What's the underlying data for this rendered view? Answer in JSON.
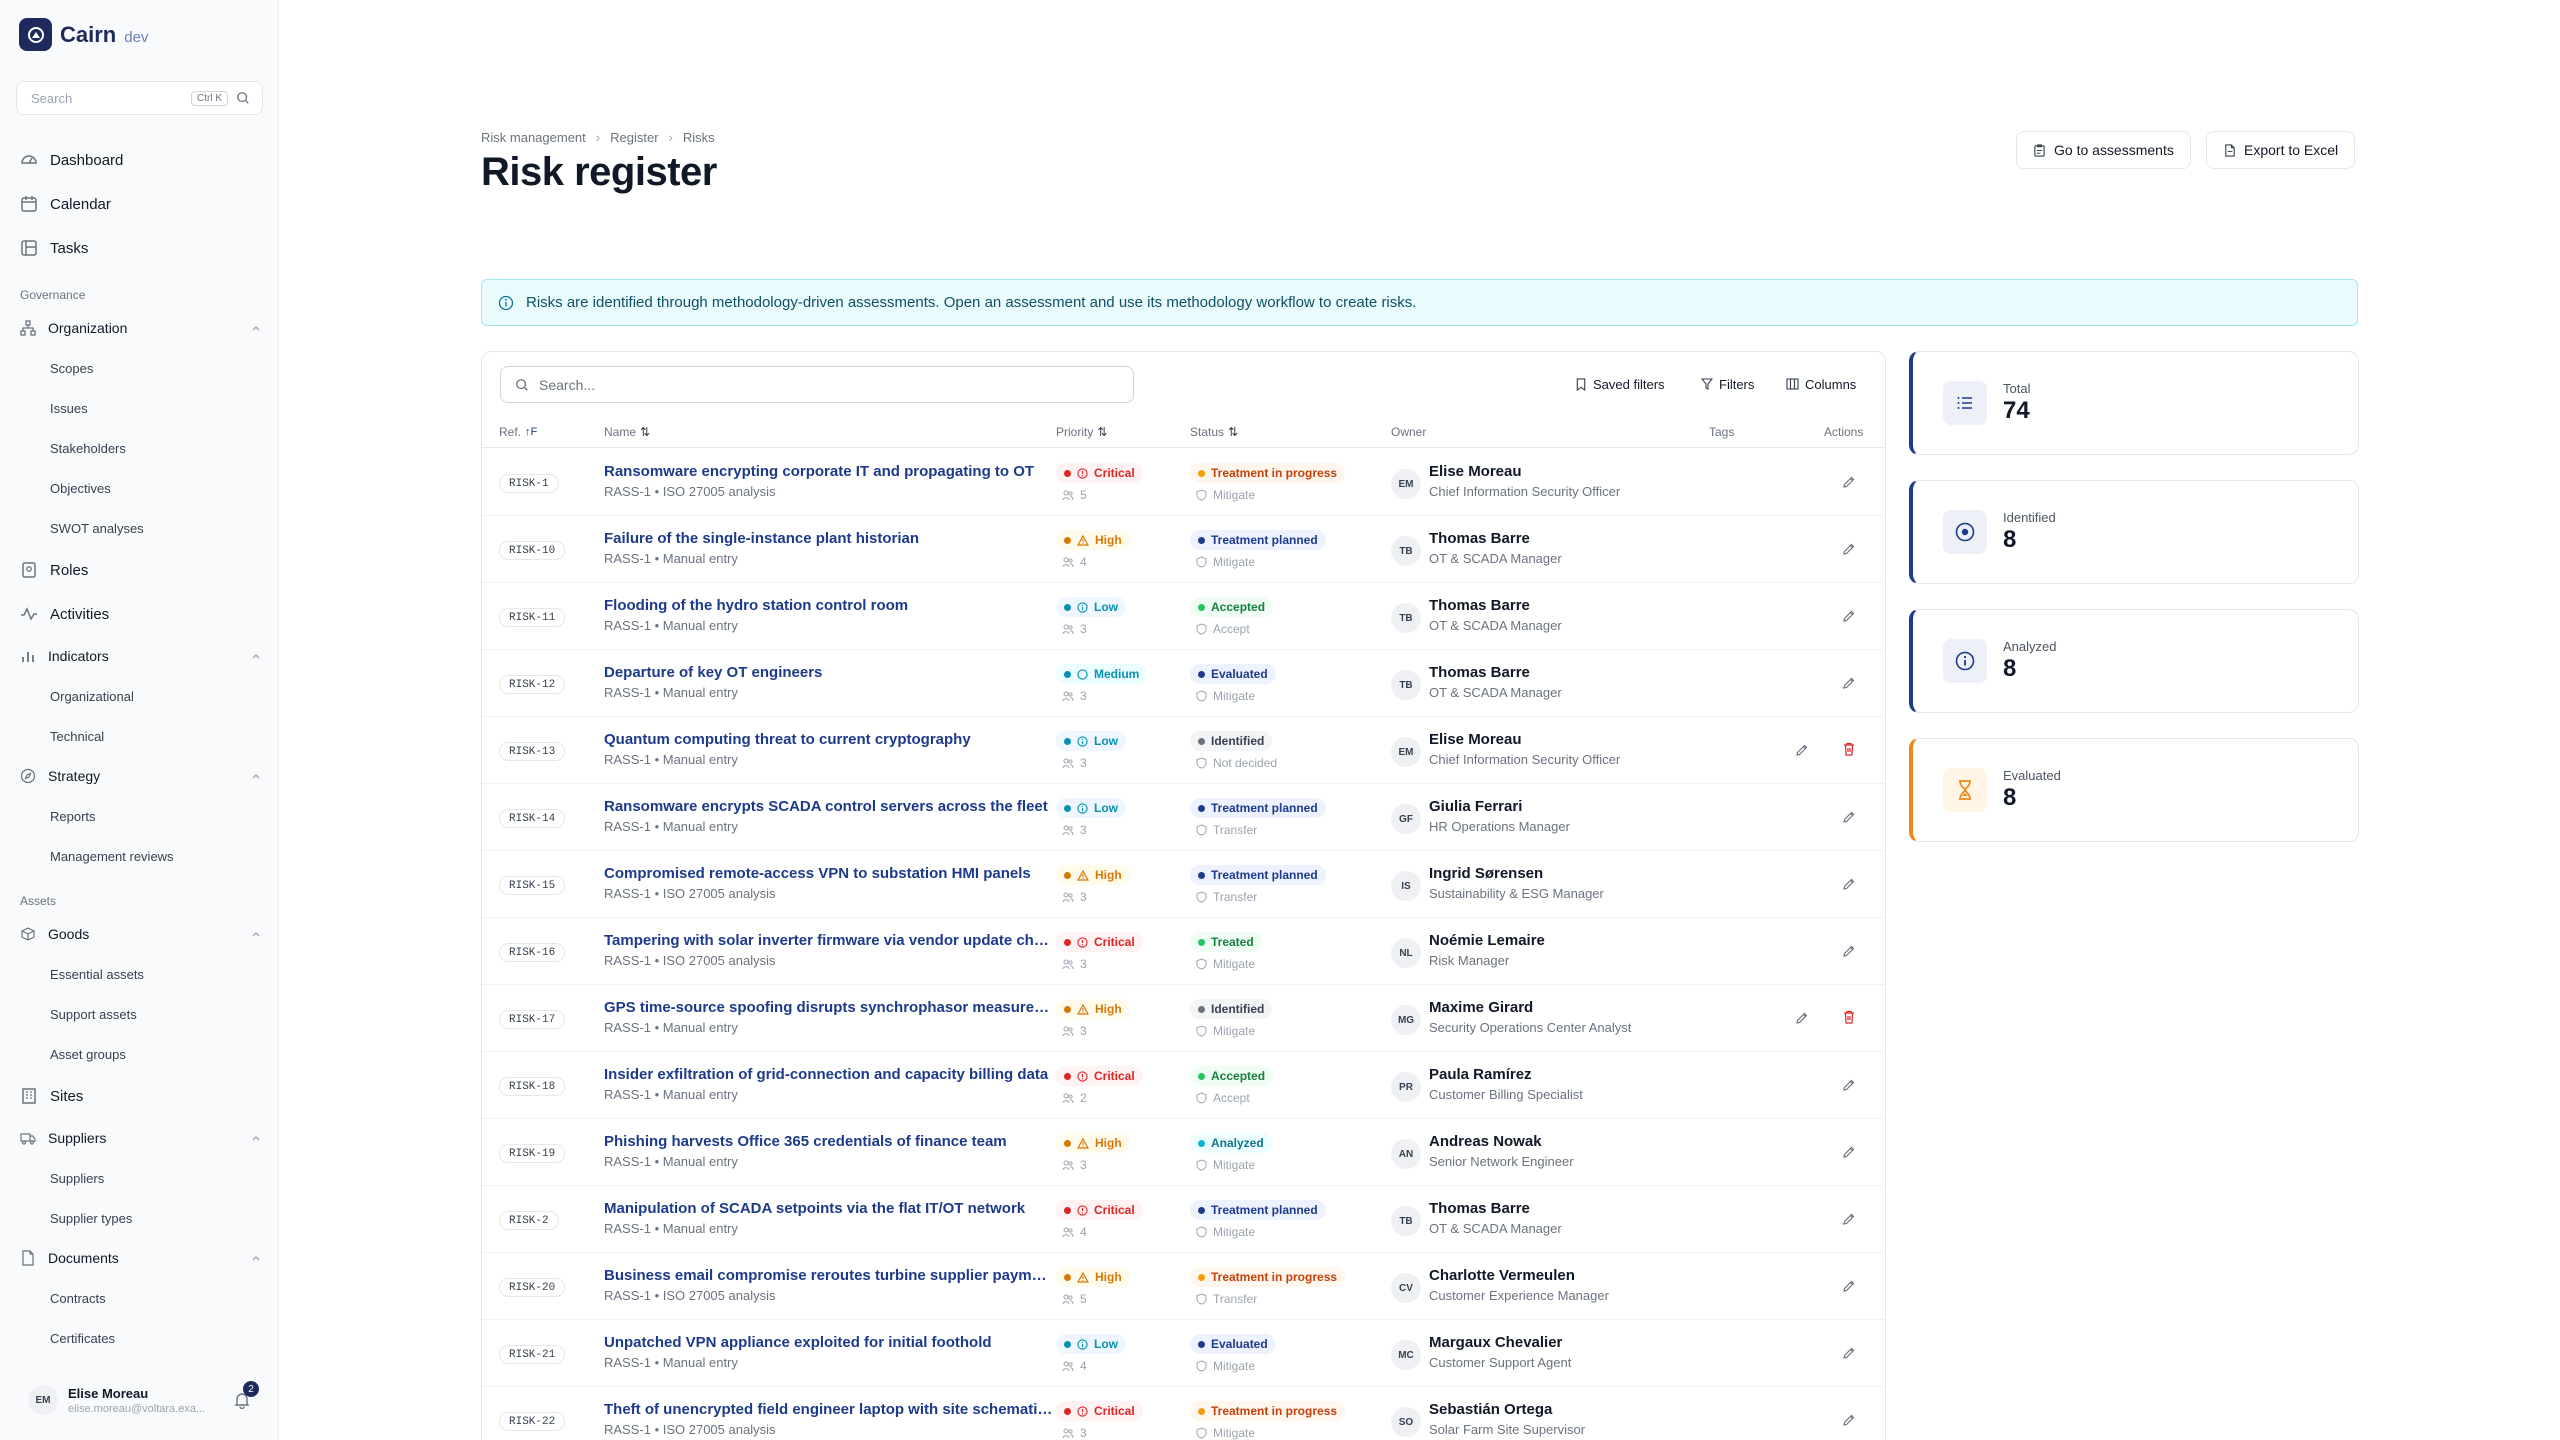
{
  "app": {
    "name": "Cairn",
    "env": "dev"
  },
  "sidebar": {
    "search_placeholder": "Search",
    "search_kbd": "Ctrl K",
    "top_items": [
      {
        "label": "Dashboard",
        "icon": "dashboard-icon"
      },
      {
        "label": "Calendar",
        "icon": "calendar-icon"
      },
      {
        "label": "Tasks",
        "icon": "tasks-icon"
      }
    ],
    "sections": {
      "governance": "Governance",
      "assets": "Assets"
    },
    "organization": {
      "label": "Organization",
      "subs": [
        "Scopes",
        "Issues",
        "Stakeholders",
        "Objectives",
        "SWOT analyses"
      ]
    },
    "roles": "Roles",
    "activities": "Activities",
    "indicators": {
      "label": "Indicators",
      "subs": [
        "Organizational",
        "Technical"
      ]
    },
    "strategy": {
      "label": "Strategy",
      "subs": [
        "Reports",
        "Management reviews"
      ]
    },
    "goods": {
      "label": "Goods",
      "subs": [
        "Essential assets",
        "Support assets",
        "Asset groups"
      ]
    },
    "sites": "Sites",
    "suppliers": {
      "label": "Suppliers",
      "subs": [
        "Suppliers",
        "Supplier types"
      ]
    },
    "documents": {
      "label": "Documents",
      "subs": [
        "Contracts",
        "Certificates"
      ]
    },
    "user": {
      "initials": "EM",
      "name": "Elise Moreau",
      "email": "elise.moreau@voltara.exa...",
      "notifications": "2"
    }
  },
  "header": {
    "breadcrumb": [
      "Risk management",
      "Register",
      "Risks"
    ],
    "title": "Risk register",
    "go_to_assessments": "Go to assessments",
    "export": "Export to Excel"
  },
  "banner": "Risks are identified through methodology-driven assessments. Open an assessment and use its methodology workflow to create risks.",
  "table": {
    "search_placeholder": "Search...",
    "saved_filters": "Saved filters",
    "filters": "Filters",
    "columns": "Columns",
    "headers": {
      "ref": "Ref.",
      "name": "Name",
      "priority": "Priority",
      "status": "Status",
      "owner": "Owner",
      "tags": "Tags",
      "actions": "Actions"
    },
    "rows": [
      {
        "ref": "RISK-1",
        "name": "Ransomware encrypting corporate IT and propagating to OT",
        "source": "RASS-1 • ISO 27005 analysis",
        "priority": "Critical",
        "count": "5",
        "status": "Treatment in progress",
        "treatment": "Mitigate",
        "initials": "EM",
        "owner": "Elise Moreau",
        "role": "Chief Information Security Officer",
        "delete": false
      },
      {
        "ref": "RISK-10",
        "name": "Failure of the single-instance plant historian",
        "source": "RASS-1 • Manual entry",
        "priority": "High",
        "count": "4",
        "status": "Treatment planned",
        "treatment": "Mitigate",
        "initials": "TB",
        "owner": "Thomas Barre",
        "role": "OT & SCADA Manager",
        "delete": false
      },
      {
        "ref": "RISK-11",
        "name": "Flooding of the hydro station control room",
        "source": "RASS-1 • Manual entry",
        "priority": "Low",
        "count": "3",
        "status": "Accepted",
        "treatment": "Accept",
        "initials": "TB",
        "owner": "Thomas Barre",
        "role": "OT & SCADA Manager",
        "delete": false
      },
      {
        "ref": "RISK-12",
        "name": "Departure of key OT engineers",
        "source": "RASS-1 • Manual entry",
        "priority": "Medium",
        "count": "3",
        "status": "Evaluated",
        "treatment": "Mitigate",
        "initials": "TB",
        "owner": "Thomas Barre",
        "role": "OT & SCADA Manager",
        "delete": false
      },
      {
        "ref": "RISK-13",
        "name": "Quantum computing threat to current cryptography",
        "source": "RASS-1 • Manual entry",
        "priority": "Low",
        "count": "3",
        "status": "Identified",
        "treatment": "Not decided",
        "initials": "EM",
        "owner": "Elise Moreau",
        "role": "Chief Information Security Officer",
        "delete": true
      },
      {
        "ref": "RISK-14",
        "name": "Ransomware encrypts SCADA control servers across the fleet",
        "source": "RASS-1 • Manual entry",
        "priority": "Low",
        "count": "3",
        "status": "Treatment planned",
        "treatment": "Transfer",
        "initials": "GF",
        "owner": "Giulia Ferrari",
        "role": "HR Operations Manager",
        "delete": false
      },
      {
        "ref": "RISK-15",
        "name": "Compromised remote-access VPN to substation HMI panels",
        "source": "RASS-1 • ISO 27005 analysis",
        "priority": "High",
        "count": "3",
        "status": "Treatment planned",
        "treatment": "Transfer",
        "initials": "IS",
        "owner": "Ingrid Sørensen",
        "role": "Sustainability & ESG Manager",
        "delete": false
      },
      {
        "ref": "RISK-16",
        "name": "Tampering with solar inverter firmware via vendor update channel",
        "source": "RASS-1 • ISO 27005 analysis",
        "priority": "Critical",
        "count": "3",
        "status": "Treated",
        "treatment": "Mitigate",
        "initials": "NL",
        "owner": "Noémie Lemaire",
        "role": "Risk Manager",
        "delete": false
      },
      {
        "ref": "RISK-17",
        "name": "GPS time-source spoofing disrupts synchrophasor measurements",
        "source": "RASS-1 • Manual entry",
        "priority": "High",
        "count": "3",
        "status": "Identified",
        "treatment": "Mitigate",
        "initials": "MG",
        "owner": "Maxime Girard",
        "role": "Security Operations Center Analyst",
        "delete": true
      },
      {
        "ref": "RISK-18",
        "name": "Insider exfiltration of grid-connection and capacity billing data",
        "source": "RASS-1 • Manual entry",
        "priority": "Critical",
        "count": "2",
        "status": "Accepted",
        "treatment": "Accept",
        "initials": "PR",
        "owner": "Paula Ramírez",
        "role": "Customer Billing Specialist",
        "delete": false
      },
      {
        "ref": "RISK-19",
        "name": "Phishing harvests Office 365 credentials of finance team",
        "source": "RASS-1 • Manual entry",
        "priority": "High",
        "count": "3",
        "status": "Analyzed",
        "treatment": "Mitigate",
        "initials": "AN",
        "owner": "Andreas Nowak",
        "role": "Senior Network Engineer",
        "delete": false
      },
      {
        "ref": "RISK-2",
        "name": "Manipulation of SCADA setpoints via the flat IT/OT network",
        "source": "RASS-1 • Manual entry",
        "priority": "Critical",
        "count": "4",
        "status": "Treatment planned",
        "treatment": "Mitigate",
        "initials": "TB",
        "owner": "Thomas Barre",
        "role": "OT & SCADA Manager",
        "delete": false
      },
      {
        "ref": "RISK-20",
        "name": "Business email compromise reroutes turbine supplier payments",
        "source": "RASS-1 • ISO 27005 analysis",
        "priority": "High",
        "count": "5",
        "status": "Treatment in progress",
        "treatment": "Transfer",
        "initials": "CV",
        "owner": "Charlotte Vermeulen",
        "role": "Customer Experience Manager",
        "delete": false
      },
      {
        "ref": "RISK-21",
        "name": "Unpatched VPN appliance exploited for initial foothold",
        "source": "RASS-1 • Manual entry",
        "priority": "Low",
        "count": "4",
        "status": "Evaluated",
        "treatment": "Mitigate",
        "initials": "MC",
        "owner": "Margaux Chevalier",
        "role": "Customer Support Agent",
        "delete": false
      },
      {
        "ref": "RISK-22",
        "name": "Theft of unencrypted field engineer laptop with site schematics",
        "source": "RASS-1 • ISO 27005 analysis",
        "priority": "Critical",
        "count": "3",
        "status": "Treatment in progress",
        "treatment": "Mitigate",
        "initials": "SO",
        "owner": "Sebastián Ortega",
        "role": "Solar Farm Site Supervisor",
        "delete": false
      }
    ]
  },
  "stats": [
    {
      "label": "Total",
      "value": "74",
      "icon": "list-icon",
      "accent": "#1e3a8a"
    },
    {
      "label": "Identified",
      "value": "8",
      "icon": "target-icon",
      "accent": "#1e3a8a"
    },
    {
      "label": "Analyzed",
      "value": "8",
      "icon": "info-icon",
      "accent": "#1e3a8a"
    },
    {
      "label": "Evaluated",
      "value": "8",
      "icon": "hourglass-icon",
      "accent": "#ea8a1a"
    }
  ],
  "colors": {
    "priority": {
      "Critical": [
        "#fef2f2",
        "#dc2626"
      ],
      "High": [
        "#fffbeb",
        "#d97706"
      ],
      "Medium": [
        "#ecfeff",
        "#0891b2"
      ],
      "Low": [
        "#eff6ff",
        "#0891b2"
      ]
    },
    "status": {
      "Treatment in progress": [
        "#fff7ed",
        "#c2410c",
        "#f59e0b"
      ],
      "Treatment planned": [
        "#eef2ff",
        "#1e3a8a",
        "#1e3a8a"
      ],
      "Accepted": [
        "#f0fdf4",
        "#15803d",
        "#22c55e"
      ],
      "Evaluated": [
        "#eef2ff",
        "#1e3a8a",
        "#1e3a8a"
      ],
      "Identified": [
        "#f3f4f6",
        "#374151",
        "#6b7280"
      ],
      "Treated": [
        "#f0fdf4",
        "#15803d",
        "#22c55e"
      ],
      "Analyzed": [
        "#ecfeff",
        "#0e7490",
        "#06b6d4"
      ]
    }
  }
}
